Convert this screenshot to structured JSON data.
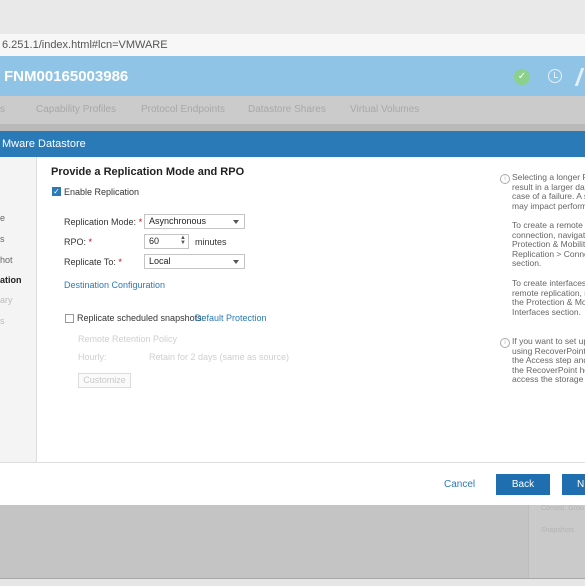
{
  "browser": {
    "url": "6.251.1/index.html#lcn=VMWARE"
  },
  "app": {
    "title": "FNM00165003986",
    "status_icon": "check-circle-icon"
  },
  "tabs": [
    {
      "label": "s"
    },
    {
      "label": "Capability Profiles"
    },
    {
      "label": "Protocol Endpoints"
    },
    {
      "label": "Datastore Shares"
    },
    {
      "label": "Virtual Volumes"
    }
  ],
  "modal": {
    "title": "Mware Datastore",
    "nav": [
      {
        "label": "e"
      },
      {
        "label": "s"
      },
      {
        "label": "hot"
      },
      {
        "label": "ation"
      },
      {
        "label": "ary"
      },
      {
        "label": "s"
      }
    ],
    "section_title": "Provide a Replication Mode and RPO",
    "enable_replication": {
      "label": "Enable Replication",
      "checked": true
    },
    "replication_mode": {
      "label": "Replication Mode:",
      "required": "*",
      "value": "Asynchronous"
    },
    "rpo": {
      "label": "RPO:",
      "required": "*",
      "value": "60",
      "unit": "minutes"
    },
    "replicate_to": {
      "label": "Replicate To:",
      "required": "*",
      "value": "Local"
    },
    "destination_link": "Destination Configuration",
    "scheduled_snapshots": {
      "label": "Replicate scheduled snapshots:",
      "checked": false,
      "link": "Default Protection"
    },
    "remote_retention": {
      "label": "Remote Retention Policy",
      "hourly_label": "Hourly:",
      "hourly_value": "Retain for 2 days (same as source)"
    },
    "customize_label": "Customize",
    "help": [
      "Selecting a longer R\nresult in a larger dat\ncase of a failure. A s\nmay impact perform",
      "To create a remote r\nconnection, navigate\nProtection & Mobility\nReplication > Conne\nsection.",
      "To create interfaces\nremote replication, n\nthe Protection & Mo\nInterfaces section.",
      "If you want to set up\nusing RecoverPoint,\nthe Access step and\nthe RecoverPoint ho\naccess the storage r"
    ],
    "footer": {
      "cancel": "Cancel",
      "back": "Back",
      "next": "N"
    }
  },
  "background": {
    "ghost_items": [
      "Consist. Grou",
      "Snapshots"
    ]
  },
  "colors": {
    "accent": "#2a7ab8",
    "header": "#8fc4e6",
    "required": "#d0021b"
  }
}
